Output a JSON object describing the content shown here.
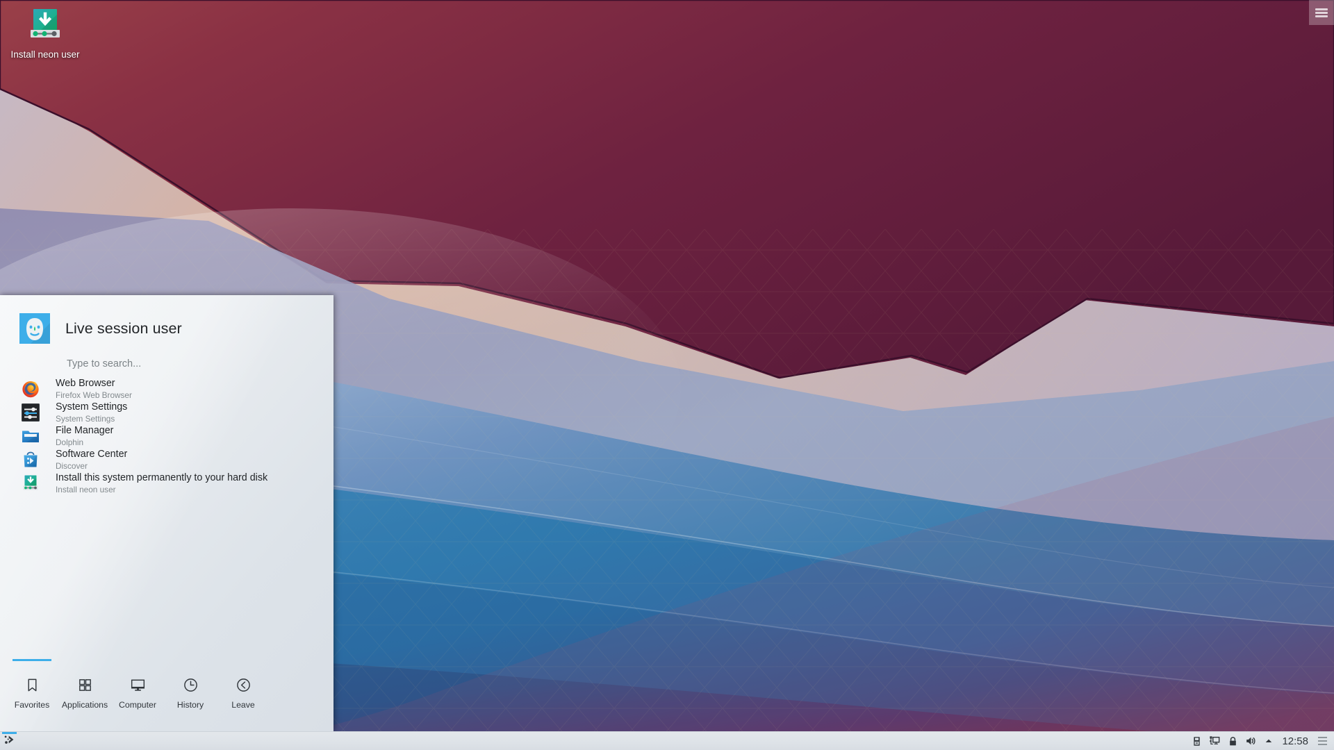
{
  "desktop": {
    "icon": {
      "name": "install-neon-user-icon",
      "label": "Install neon user"
    },
    "toolbox": {
      "name": "desktop-toolbox-icon",
      "label": "Desktop Toolbox"
    },
    "wallpaper": {
      "name": "cascade-wallpaper",
      "colors": {
        "maroon_top_left": "#8e3a44",
        "maroon_deep": "#5d1b3b",
        "maroon_mid": "#742241",
        "peach_band": "#d6b09c",
        "lavender": "#9a95b8",
        "blue_light": "#9fb4d2",
        "blue_mid": "#2f76ab",
        "blue_deep": "#1f5f93",
        "blue_dark": "#2b4a7a",
        "purple_bottom": "#4e3360"
      }
    }
  },
  "kickoff": {
    "user": "Live session user",
    "avatar_name": "user-avatar",
    "search": {
      "placeholder": "Type to search...",
      "value": ""
    },
    "favorites": [
      {
        "icon": "firefox-icon",
        "title": "Web Browser",
        "subtitle": "Firefox Web Browser"
      },
      {
        "icon": "system-settings-icon",
        "title": "System Settings",
        "subtitle": "System Settings"
      },
      {
        "icon": "folder-icon",
        "title": "File Manager",
        "subtitle": "Dolphin"
      },
      {
        "icon": "software-center-icon",
        "title": "Software Center",
        "subtitle": "Discover"
      },
      {
        "icon": "install-icon",
        "title": "Install this system permanently to your hard disk",
        "subtitle": "Install neon user"
      }
    ],
    "tabs": [
      {
        "label": "Favorites",
        "icon": "bookmark-icon",
        "active": true
      },
      {
        "label": "Applications",
        "icon": "grid-icon",
        "active": false
      },
      {
        "label": "Computer",
        "icon": "monitor-icon",
        "active": false
      },
      {
        "label": "History",
        "icon": "clock-icon",
        "active": false
      },
      {
        "label": "Leave",
        "icon": "leave-icon",
        "active": false
      }
    ],
    "accent_color": "#3daee9"
  },
  "taskbar": {
    "launcher": {
      "name": "plasma-launcher-icon",
      "label": "Application Launcher"
    },
    "tray": [
      {
        "name": "removable-device-icon",
        "label": "Removable Devices"
      },
      {
        "name": "network-icon",
        "label": "Network"
      },
      {
        "name": "lock-icon",
        "label": "Keyboard / Lock"
      },
      {
        "name": "volume-icon",
        "label": "Audio Volume"
      },
      {
        "name": "show-hidden-icon",
        "label": "Show hidden icons"
      }
    ],
    "clock": "12:58",
    "menu": {
      "name": "panel-menu-icon",
      "label": "Panel Options"
    }
  }
}
